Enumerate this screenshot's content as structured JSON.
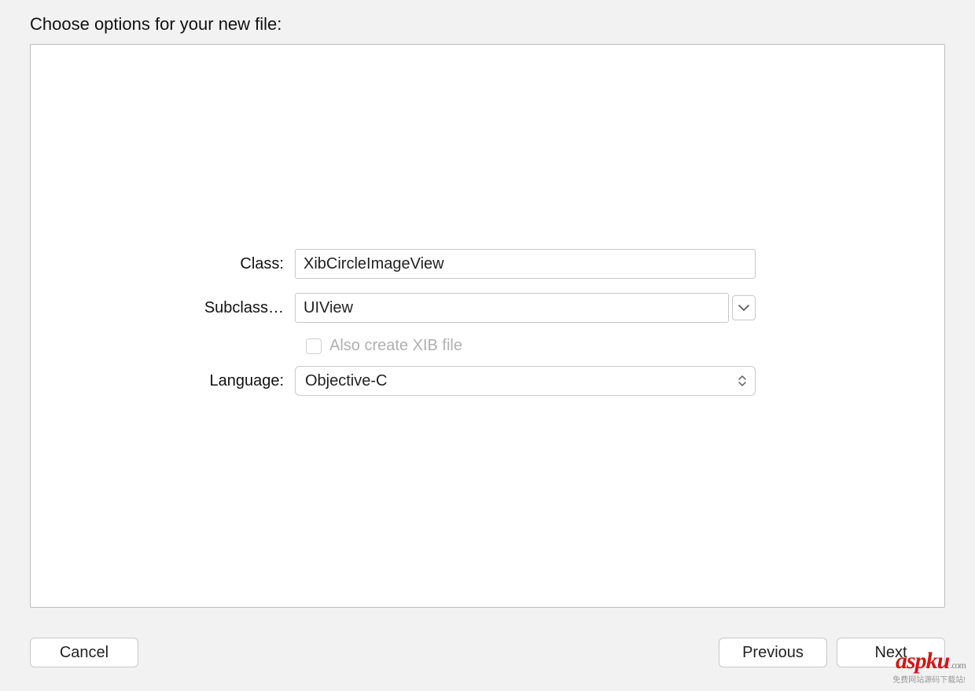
{
  "heading": "Choose options for your new file:",
  "form": {
    "class_label": "Class:",
    "class_value": "XibCircleImageView",
    "subclass_label": "Subclass…",
    "subclass_value": "UIView",
    "also_create_xib_label": "Also create XIB file",
    "also_create_xib_checked": false,
    "also_create_xib_enabled": false,
    "language_label": "Language:",
    "language_value": "Objective-C"
  },
  "buttons": {
    "cancel": "Cancel",
    "previous": "Previous",
    "next": "Next"
  },
  "watermark": {
    "brand_prefix": "asp",
    "brand_suffix": "ku",
    "domain_suffix": ".com",
    "tagline": "免费网站源码下载站!"
  }
}
